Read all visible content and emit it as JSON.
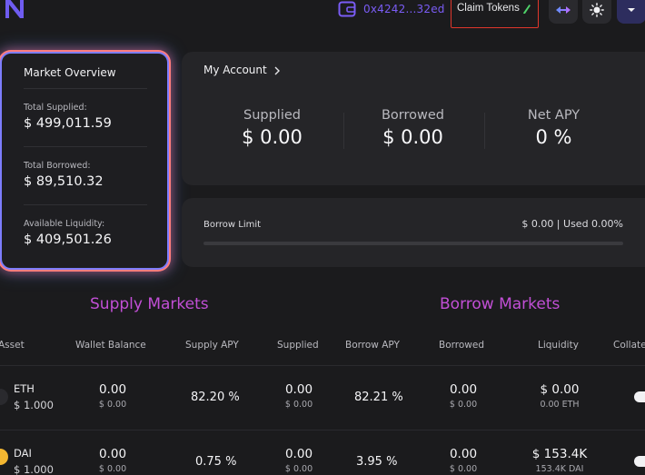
{
  "header": {
    "wallet_address": "0x4242...32ed",
    "claim_tokens_label": "Claim Tokens",
    "colors": {
      "accent": "#7a5cf5",
      "highlight_border": "#e0372c"
    }
  },
  "market_overview": {
    "title": "Market Overview",
    "total_supplied_label": "Total Supplied:",
    "total_supplied_value": "$ 499,011.59",
    "total_borrowed_label": "Total Borrowed:",
    "total_borrowed_value": "$ 89,510.32",
    "available_liquidity_label": "Available Liquidity:",
    "available_liquidity_value": "$ 409,501.26"
  },
  "account": {
    "title": "My Account",
    "supplied_label": "Supplied",
    "supplied_value": "$ 0.00",
    "borrowed_label": "Borrowed",
    "borrowed_value": "$ 0.00",
    "net_apy_label": "Net APY",
    "net_apy_value": "0 %"
  },
  "borrow_limit": {
    "label": "Borrow Limit",
    "value": "$ 0.00 | Used 0.00%",
    "used_fraction": 0
  },
  "sections": {
    "supply_markets": "Supply Markets",
    "borrow_markets": "Borrow Markets"
  },
  "table": {
    "columns": [
      "Asset",
      "Wallet Balance",
      "Supply APY",
      "Supplied",
      "Borrow APY",
      "Borrowed",
      "Liquidity",
      "Collate"
    ],
    "rows": [
      {
        "asset": "ETH",
        "price": "$ 1.000",
        "wallet_balance": "0.00",
        "wallet_balance_usd": "$ 0.00",
        "supply_apy": "82.20 %",
        "supplied": "0.00",
        "supplied_usd": "$ 0.00",
        "borrow_apy": "82.21 %",
        "borrowed": "0.00",
        "borrowed_usd": "$ 0.00",
        "liquidity": "$ 0.00",
        "liquidity_token": "0.00 ETH"
      },
      {
        "asset": "DAI",
        "price": "$ 1.000",
        "wallet_balance": "0.00",
        "wallet_balance_usd": "$ 0.00",
        "supply_apy": "0.75 %",
        "supplied": "0.00",
        "supplied_usd": "$ 0.00",
        "borrow_apy": "3.95 %",
        "borrowed": "0.00",
        "borrowed_usd": "$ 0.00",
        "liquidity": "$ 153.4K",
        "liquidity_token": "153.4K DAI"
      }
    ]
  }
}
